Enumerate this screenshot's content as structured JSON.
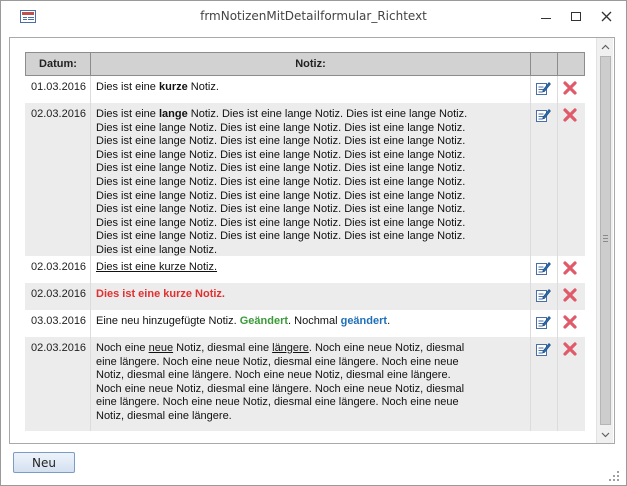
{
  "window": {
    "title": "frmNotizenMitDetailformular_Richtext"
  },
  "table": {
    "headers": {
      "date": "Datum:",
      "note": "Notiz:"
    },
    "rows": [
      {
        "date": "01.03.2016",
        "parts": [
          {
            "t": "Dies ist eine "
          },
          {
            "t": "kurze",
            "s": "b"
          },
          {
            "t": " Notiz."
          }
        ]
      },
      {
        "date": "02.03.2016",
        "long": true
      },
      {
        "date": "02.03.2016",
        "parts": [
          {
            "t": "Dies ist eine kurze Notiz.",
            "s": "u"
          }
        ]
      },
      {
        "date": "02.03.2016",
        "parts": [
          {
            "t": "Dies ist eine kurze Notiz.",
            "s": "red"
          }
        ]
      },
      {
        "date": "03.03.2016",
        "parts": [
          {
            "t": "Eine neu hinzugefügte Notiz. "
          },
          {
            "t": "Geändert",
            "s": "green"
          },
          {
            "t": ". Nochmal "
          },
          {
            "t": "geändert",
            "s": "blue"
          },
          {
            "t": "."
          }
        ]
      },
      {
        "date": "02.03.2016",
        "long2": true
      }
    ],
    "long_note_lines": [
      [
        "Dies ist eine ",
        "lange",
        " Notiz. Dies ist eine lange Notiz. Dies ist eine lange Notiz."
      ],
      "Dies ist eine lange Notiz. Dies ist eine lange Notiz. Dies ist eine lange Notiz.",
      "Dies ist eine lange Notiz. Dies ist eine lange Notiz. Dies ist eine lange Notiz.",
      "Dies ist eine lange Notiz. Dies ist eine lange Notiz. Dies ist eine lange Notiz.",
      "Dies ist eine lange Notiz. Dies ist eine lange Notiz. Dies ist eine lange Notiz.",
      "Dies ist eine lange Notiz. Dies ist eine lange Notiz. Dies ist eine lange Notiz.",
      "Dies ist eine lange Notiz. Dies ist eine lange Notiz. Dies ist eine lange Notiz.",
      "Dies ist eine lange Notiz. Dies ist eine lange Notiz. Dies ist eine lange Notiz.",
      "Dies ist eine lange Notiz. Dies ist eine lange Notiz. Dies ist eine lange Notiz.",
      "Dies ist eine lange Notiz. Dies ist eine lange Notiz. Dies ist eine lange Notiz.",
      "Dies ist eine lange Notiz."
    ],
    "long2_lines": [
      [
        "Noch eine ",
        "neue",
        " Notiz, diesmal eine ",
        "längere",
        ". Noch eine neue Notiz, diesmal"
      ],
      "eine längere. Noch eine neue Notiz, diesmal eine längere. Noch eine neue",
      "Notiz, diesmal eine längere. Noch eine neue Notiz, diesmal eine längere.",
      "Noch eine neue Notiz, diesmal eine längere. Noch eine neue Notiz, diesmal",
      "eine längere. Noch eine neue Notiz, diesmal eine längere. Noch eine neue",
      "Notiz, diesmal eine längere."
    ]
  },
  "buttons": {
    "new_label": "Neu"
  },
  "icons": {
    "edit": "edit-note-icon",
    "delete": "delete-x-icon",
    "colors": {
      "delete": "#e05a6a",
      "edit": "#2a6aa8",
      "header_bg": "#d2d2d2",
      "alt_row": "#ececec"
    }
  }
}
